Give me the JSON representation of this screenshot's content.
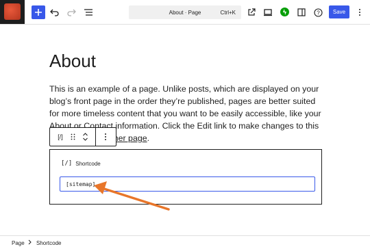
{
  "header": {
    "document_title": "About · Page",
    "shortcut": "Ctrl+K",
    "save_label": "Save"
  },
  "content": {
    "title": "About",
    "paragraph_before": "This is an example of a page. Unlike posts, which are displayed on your blog’s front page in the order they’re published, pages are better suited for more timeless content that you want to be easily accessible, like your About or Contact information. Click the Edit link to make changes to this page or ",
    "paragraph_link": "add another page",
    "paragraph_after": "."
  },
  "shortcode_block": {
    "label": "Shortcode",
    "icon_text": "[/]",
    "value": "[sitemap]"
  },
  "block_toolbar": {
    "icon_text": "[/]"
  },
  "breadcrumbs": [
    "Page",
    "Shortcode"
  ],
  "colors": {
    "accent": "#3858e9",
    "jetpack": "#069e08",
    "annotation_arrow": "#e8762a"
  }
}
